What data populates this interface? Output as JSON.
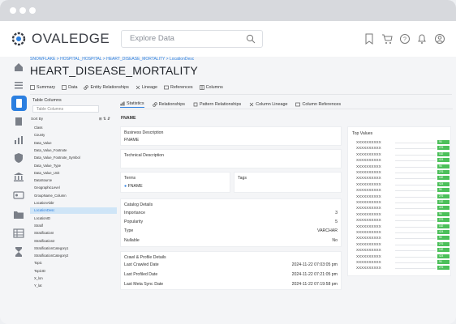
{
  "app": {
    "logo": "OVALEDGE",
    "search_placeholder": "Explore Data",
    "colors": {
      "accent": "#2b7fe0",
      "bar": "#4cc05a"
    }
  },
  "breadcrumb": "SNOWFLAKE > HOSPITAL_HOSPITAL > HEART_DISEASE_MORTALITY > LocationDesc",
  "page_title": "HEART_DISEASE_MORTALITY",
  "top_tabs": [
    "Summary",
    "Data",
    "Entity Relationships",
    "Lineage",
    "References",
    "Columns"
  ],
  "column_panel": {
    "title": "Table Columns",
    "search_placeholder": "Table Columns",
    "sort_label": "Sort By",
    "items": [
      "Class",
      "County",
      "Data_Value",
      "Data_Value_Footnote",
      "Data_Value_Footnote_Symbol",
      "Data_Value_Type",
      "Data_Value_Unit",
      "DataSource",
      "GeographicLevel",
      "GroupName_Column",
      "LocationAbbr",
      "LocationDesc",
      "LocationID",
      "Stratif",
      "StratificationI",
      "Stratification2",
      "StratificationCategory1",
      "StratificationCategory2",
      "Topic",
      "TopicID",
      "X_lon",
      "Y_lat"
    ],
    "selected": "LocationDesc"
  },
  "sub_tabs": [
    "Statistics",
    "Relationships",
    "Pattern Relationships",
    "Column Lineage",
    "Column References"
  ],
  "field_name": "FNAME",
  "business_description": {
    "label": "Business Description",
    "value": "FNAME"
  },
  "technical_description": {
    "label": "Technical Description"
  },
  "terms": {
    "label": "Terms",
    "value": "FNAME"
  },
  "tags": {
    "label": "Tags"
  },
  "catalog": {
    "title": "Catalog Details",
    "rows": [
      {
        "k": "Importance",
        "v": "3"
      },
      {
        "k": "Popularity",
        "v": "5"
      },
      {
        "k": "Type",
        "v": "VARCHAR"
      },
      {
        "k": "Nullable",
        "v": "No"
      }
    ]
  },
  "crawl": {
    "title": "Crawl & Profile Details",
    "rows": [
      {
        "k": "Last Crawled Date",
        "v": "2024-11-22  07:03:05 pm"
      },
      {
        "k": "Last Profiled Date",
        "v": "2024-11-22  07:21:05 pm"
      },
      {
        "k": "Last Meta Sync Date",
        "v": "2024-11-22  07:19:58 pm"
      }
    ]
  },
  "top_values": {
    "title": "Top Values",
    "rows": [
      {
        "name": "XXXXXXXXXX",
        "value": 96
      },
      {
        "name": "XXXXXXXXXX",
        "value": 276
      },
      {
        "name": "XXXXXXXXXX",
        "value": 182
      },
      {
        "name": "XXXXXXXXXX",
        "value": 424
      },
      {
        "name": "XXXXXXXXXX",
        "value": 96
      },
      {
        "name": "XXXXXXXXXX",
        "value": 276
      },
      {
        "name": "XXXXXXXXXX",
        "value": 182
      },
      {
        "name": "XXXXXXXXXX",
        "value": 424
      },
      {
        "name": "XXXXXXXXXX",
        "value": 96
      },
      {
        "name": "XXXXXXXXXX",
        "value": 276
      },
      {
        "name": "XXXXXXXXXX",
        "value": 182
      },
      {
        "name": "XXXXXXXXXX",
        "value": 424
      },
      {
        "name": "XXXXXXXXXX",
        "value": 96
      },
      {
        "name": "XXXXXXXXXX",
        "value": 276
      },
      {
        "name": "XXXXXXXXXX",
        "value": 182
      },
      {
        "name": "XXXXXXXXXX",
        "value": 424
      },
      {
        "name": "XXXXXXXXXX",
        "value": 96
      },
      {
        "name": "XXXXXXXXXX",
        "value": 276
      },
      {
        "name": "XXXXXXXXXX",
        "value": 182
      },
      {
        "name": "XXXXXXXXXX",
        "value": 424
      },
      {
        "name": "XXXXXXXXXX",
        "value": 96
      },
      {
        "name": "XXXXXXXXXX",
        "value": 276
      }
    ]
  }
}
